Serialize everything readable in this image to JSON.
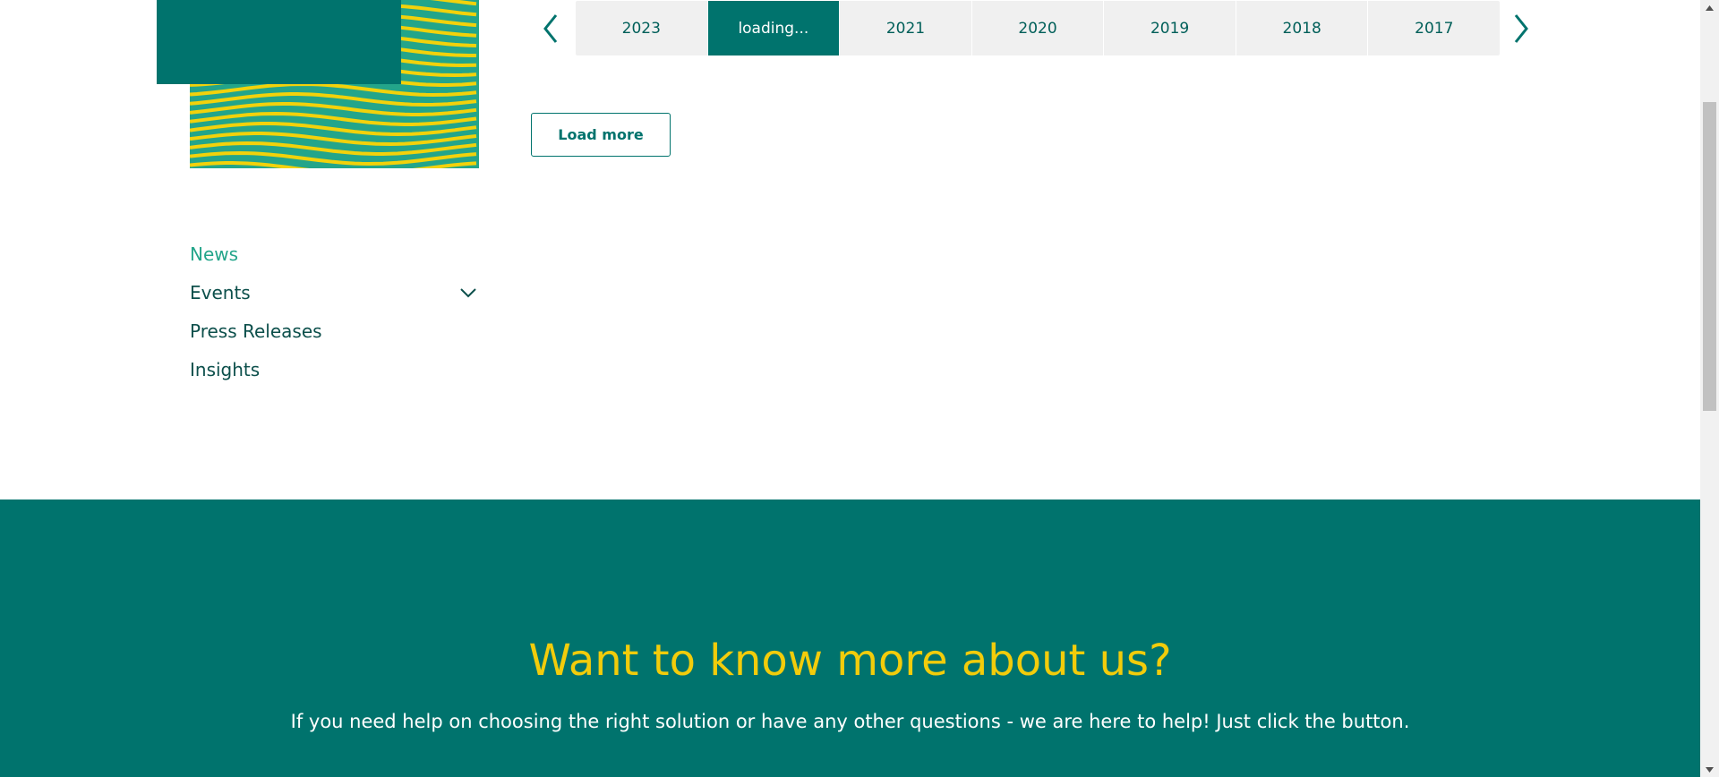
{
  "year_tabs": {
    "prev_icon": "chevron-left-icon",
    "next_icon": "chevron-right-icon",
    "items": [
      {
        "label": "2023"
      },
      {
        "label": "loading..."
      },
      {
        "label": "2021"
      },
      {
        "label": "2020"
      },
      {
        "label": "2019"
      },
      {
        "label": "2018"
      },
      {
        "label": "2017"
      }
    ]
  },
  "load_more_label": "Load more",
  "sidebar": {
    "items": [
      {
        "label": "News"
      },
      {
        "label": "Events"
      },
      {
        "label": "Press Releases"
      },
      {
        "label": "Insights"
      }
    ]
  },
  "cta": {
    "title": "Want to know more about us?",
    "text": "If you need help on choosing the right solution or have any other questions - we are here to help! Just click the button."
  },
  "colors": {
    "brand_teal": "#00736d",
    "accent_yellow": "#f2cc0b",
    "active_green": "#23a58a"
  }
}
